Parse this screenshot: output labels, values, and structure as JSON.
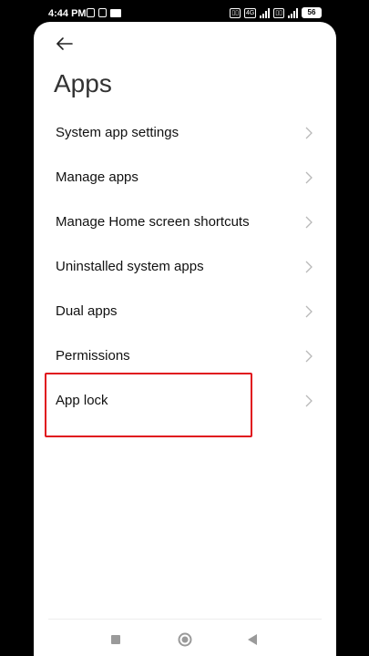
{
  "status_bar": {
    "time": "4:44 PM",
    "network": "4G",
    "battery": "56"
  },
  "header": {
    "back_icon": "arrow-left-icon",
    "title": "Apps"
  },
  "menu": {
    "items": [
      {
        "label": "System app settings"
      },
      {
        "label": "Manage apps"
      },
      {
        "label": "Manage Home screen shortcuts"
      },
      {
        "label": "Uninstalled system apps"
      },
      {
        "label": "Dual apps"
      },
      {
        "label": "Permissions"
      },
      {
        "label": "App lock"
      }
    ]
  },
  "annotation": {
    "highlight_color": "#e0121c",
    "highlighted_item": "App lock"
  },
  "nav_bar": {
    "recent_icon": "square-icon",
    "home_icon": "circle-icon",
    "back_icon": "triangle-back-icon"
  }
}
